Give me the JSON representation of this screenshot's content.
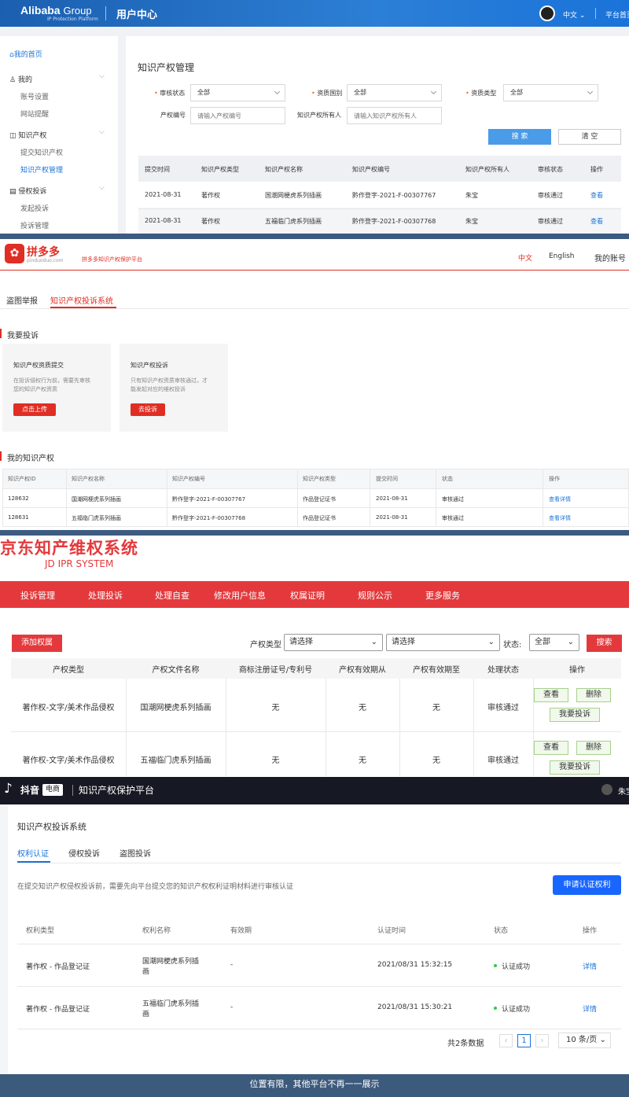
{
  "alibaba": {
    "logo_main": "Alibaba",
    "logo_group": "Group",
    "logo_sub": "IP Protection Platform",
    "section": "用户中心",
    "lang": "中文",
    "platform_home": "平台首页",
    "sidebar": {
      "home": "我的首页",
      "mine": "我的",
      "account_settings": "账号设置",
      "site_notice": "网站提醒",
      "ip": "知识产权",
      "submit_ip": "提交知识产权",
      "ip_manage": "知识产权管理",
      "complaint": "侵权投诉",
      "start_complaint": "发起投诉",
      "complaint_manage": "投诉管理"
    },
    "page_title": "知识产权管理",
    "filters": {
      "review_status_label": "审核状态",
      "review_status_value": "全部",
      "region_label": "资质国别",
      "region_value": "全部",
      "type_label": "资质类型",
      "type_value": "全部",
      "ip_no_label": "产权编号",
      "ip_no_placeholder": "请输入产权编号",
      "owner_label": "知识产权所有人",
      "owner_placeholder": "请输入知识产权所有人"
    },
    "search_btn": "搜 索",
    "clear_btn": "清 空",
    "table_headers": [
      "提交时间",
      "知识产权类型",
      "知识产权名称",
      "知识产权编号",
      "知识产权所有人",
      "审核状态",
      "操作"
    ],
    "rows": [
      [
        "2021-08-31",
        "著作权",
        "国潮网梗虎系列插画",
        "黔作登字-2021-F-00307767",
        "朱宝",
        "审核通过",
        "查看"
      ],
      [
        "2021-08-31",
        "著作权",
        "五福临门虎系列插画",
        "黔作登字-2021-F-00307768",
        "朱宝",
        "审核通过",
        "查看"
      ]
    ]
  },
  "pdd": {
    "logo": "拼多多",
    "domain": "pinduoduo.com",
    "platform": "拼多多知识产权保护平台",
    "lang_cn": "中文",
    "lang_en": "English",
    "account": "我的账号",
    "tabs": [
      "盗图举报",
      "知识产权投诉系统"
    ],
    "complain_title": "我要投诉",
    "card1": {
      "title": "知识产权资质提交",
      "desc1": "在投诉侵权行为前，需要先审核",
      "desc2": "您的知识产权资质",
      "btn": "点击上传"
    },
    "card2": {
      "title": "知识产权投诉",
      "desc1": "只有知识产权资质审核通过，才",
      "desc2": "能发起对应的维权投诉",
      "btn": "去投诉"
    },
    "my_ip_title": "我的知识产权",
    "table_headers": [
      "知识产权ID",
      "知识产权名称",
      "知识产权编号",
      "知识产权类型",
      "提交时间",
      "状态",
      "操作"
    ],
    "rows": [
      [
        "128632",
        "国潮网梗虎系列插画",
        "黔作登字-2021-F-00307767",
        "作品登记证书",
        "2021-08-31",
        "审核通过",
        "查看详情"
      ],
      [
        "128631",
        "五福临门虎系列插画",
        "黔作登字-2021-F-00307768",
        "作品登记证书",
        "2021-08-31",
        "审核通过",
        "查看详情"
      ]
    ]
  },
  "jd": {
    "title": "京东知产维权系统",
    "subtitle": "JD IPR SYSTEM",
    "nav": [
      "投诉管理",
      "处理投诉",
      "处理自查",
      "修改用户信息",
      "权属证明",
      "规则公示",
      "更多服务"
    ],
    "add_btn": "添加权属",
    "type_label": "产权类型",
    "select1": "请选择",
    "select2": "请选择",
    "status_label": "状态:",
    "status_value": "全部",
    "search_btn": "搜索",
    "table_headers": [
      "产权类型",
      "产权文件名称",
      "商标注册证号/专利号",
      "产权有效期从",
      "产权有效期至",
      "处理状态",
      "操作"
    ],
    "rows": [
      [
        "著作权-文字/美术作品侵权",
        "国潮网梗虎系列插画",
        "无",
        "无",
        "无",
        "审核通过"
      ],
      [
        "著作权-文字/美术作品侵权",
        "五福临门虎系列插画",
        "无",
        "无",
        "无",
        "审核通过"
      ]
    ],
    "view_btn": "查看",
    "delete_btn": "删除",
    "complain_btn": "我要投诉"
  },
  "douyin": {
    "brand": "抖音",
    "brand_tag": "电商",
    "platform": "知识产权保护平台",
    "user": "朱宝",
    "system_title": "知识产权投诉系统",
    "tabs": [
      "权利认证",
      "侵权投诉",
      "盗图投诉"
    ],
    "notice": "在提交知识产权侵权投诉前，需要先向平台提交您的知识产权权利证明材料进行审核认证",
    "apply_btn": "申请认证权利",
    "table_headers": [
      "权利类型",
      "权利名称",
      "有效期",
      "认证时间",
      "状态",
      "操作"
    ],
    "rows": [
      {
        "type": "著作权 - 作品登记证",
        "name1": "国潮网梗虎系列插",
        "name2": "画",
        "validity": "-",
        "time": "2021/08/31 15:32:15",
        "status": "认证成功",
        "op": "详情"
      },
      {
        "type": "著作权 - 作品登记证",
        "name1": "五福临门虎系列插",
        "name2": "画",
        "validity": "-",
        "time": "2021/08/31 15:30:21",
        "status": "认证成功",
        "op": "详情"
      }
    ],
    "total": "共2条数据",
    "page": "1",
    "page_size": "10 条/页"
  },
  "footer": "位置有限，其他平台不再一一展示",
  "colors": {
    "ali_blue": "#1a73d9",
    "pdd_red": "#e02e24",
    "jd_red": "#e4393c",
    "douyin_dark": "#161823",
    "footer": "#3c5a7c"
  }
}
